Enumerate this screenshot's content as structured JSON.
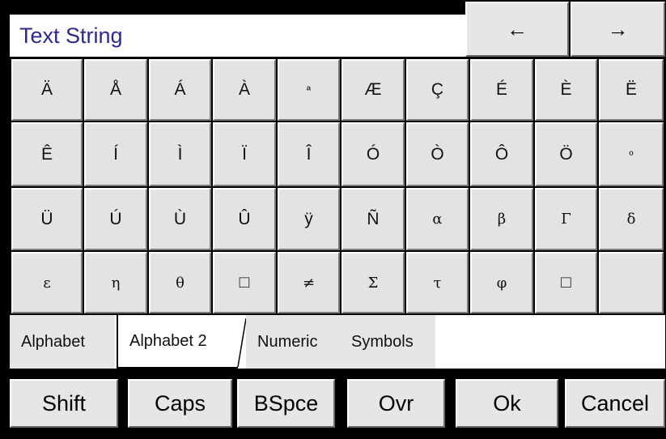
{
  "title": "Text String",
  "nav": {
    "left_arrow": "←",
    "right_arrow": "→"
  },
  "keys": [
    [
      "Ä",
      "Å",
      "Á",
      "À",
      "ª",
      "Æ",
      "Ç",
      "É",
      "È",
      "Ë"
    ],
    [
      "Ê",
      "Í",
      "Ì",
      "Ï",
      "Î",
      "Ó",
      "Ò",
      "Ô",
      "Ö",
      "º"
    ],
    [
      "Ü",
      "Ú",
      "Ù",
      "Û",
      "ÿ",
      "Ñ",
      "α",
      "β",
      "Γ",
      "δ"
    ],
    [
      "ε",
      "η",
      "θ",
      "□",
      "≠",
      "Σ",
      "τ",
      "φ",
      "□",
      ""
    ]
  ],
  "tabs": [
    "Alphabet",
    "Alphabet 2",
    "Numeric",
    "Symbols"
  ],
  "active_tab": "Alphabet 2",
  "commands": [
    "Shift",
    "Caps",
    "BSpce",
    "Ovr",
    "Ok",
    "Cancel"
  ],
  "colors": {
    "title_text": "#2a2a8e",
    "key_face": "#e3e3e3",
    "frame": "#000000"
  }
}
